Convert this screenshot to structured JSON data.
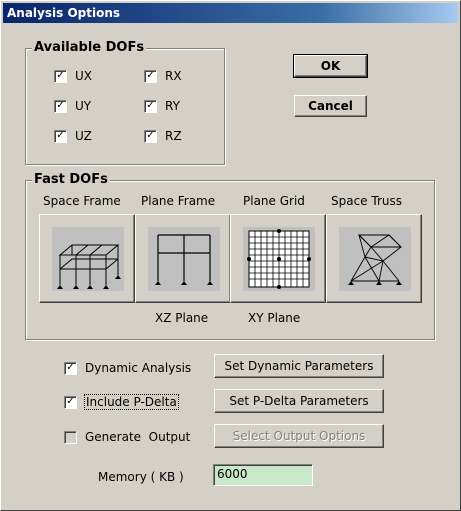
{
  "window": {
    "title": "Analysis Options"
  },
  "available_dofs": {
    "title": "Available DOFs",
    "items": [
      {
        "label": "UX",
        "checked": true
      },
      {
        "label": "RX",
        "checked": true
      },
      {
        "label": "UY",
        "checked": true
      },
      {
        "label": "RY",
        "checked": true
      },
      {
        "label": "UZ",
        "checked": true
      },
      {
        "label": "RZ",
        "checked": true
      }
    ]
  },
  "buttons": {
    "ok": "OK",
    "cancel": "Cancel"
  },
  "fast_dofs": {
    "title": "Fast DOFs",
    "options": [
      {
        "label": "Space Frame",
        "sublabel": ""
      },
      {
        "label": "Plane Frame",
        "sublabel": "XZ Plane"
      },
      {
        "label": "Plane Grid",
        "sublabel": "XY Plane"
      },
      {
        "label": "Space Truss",
        "sublabel": ""
      }
    ]
  },
  "options": {
    "dynamic": {
      "label": "Dynamic Analysis",
      "checked": true,
      "button": "Set Dynamic Parameters"
    },
    "pdelta": {
      "label": "Include P-Delta",
      "checked": true,
      "button": "Set P-Delta Parameters"
    },
    "output": {
      "label": "Generate  Output",
      "checked": false,
      "button": "Select Output Options"
    }
  },
  "memory": {
    "label": "Memory ( KB )",
    "value": "6000"
  },
  "colors": {
    "titlebar": "#0a246a",
    "face": "#d4d0c8",
    "memory_field": "#c8e8c8"
  }
}
